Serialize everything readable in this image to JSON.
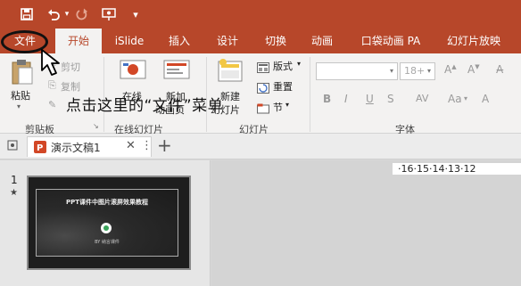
{
  "qat": {
    "save_icon": "save-icon",
    "undo_icon": "undo-icon",
    "redo_icon": "redo-icon",
    "present_icon": "present-from-start-icon",
    "customize_icon": "customize-qat-icon"
  },
  "tabs": [
    {
      "label": "文件"
    },
    {
      "label": "开始"
    },
    {
      "label": "iSlide"
    },
    {
      "label": "插入"
    },
    {
      "label": "设计"
    },
    {
      "label": "切换"
    },
    {
      "label": "动画"
    },
    {
      "label": "口袋动画 PA"
    },
    {
      "label": "幻灯片放映"
    }
  ],
  "ribbon": {
    "clipboard": {
      "paste": "粘贴",
      "cut": "剪切",
      "copy": "复制",
      "label": "剪贴板"
    },
    "online": {
      "online_btn": "在线",
      "new_btn_1": "新加",
      "new_btn_2": "动画页",
      "label": "在线幻灯片"
    },
    "slides": {
      "new_slide_1": "新建",
      "new_slide_2": "幻灯片",
      "layout": "版式",
      "reset": "重置",
      "section": "节",
      "label": "幻灯片"
    },
    "font": {
      "font_size": "18+",
      "bold": "B",
      "italic": "I",
      "underline": "U",
      "strike": "S",
      "spacing": "AV",
      "case": "Aa",
      "label": "字体"
    }
  },
  "instruction": "点击这里的“文件”菜单",
  "doc": {
    "tab_label": "演示文稿1",
    "close": "✕",
    "more": "⋮",
    "new_tab": "+"
  },
  "thumbnails": {
    "slide_number": "1",
    "star": "★",
    "slide_title": "PPT课件中图片滚屏效果教程",
    "slide_sub": "BY 纳言课件"
  },
  "ruler_text": "·16·15·14·13·12"
}
